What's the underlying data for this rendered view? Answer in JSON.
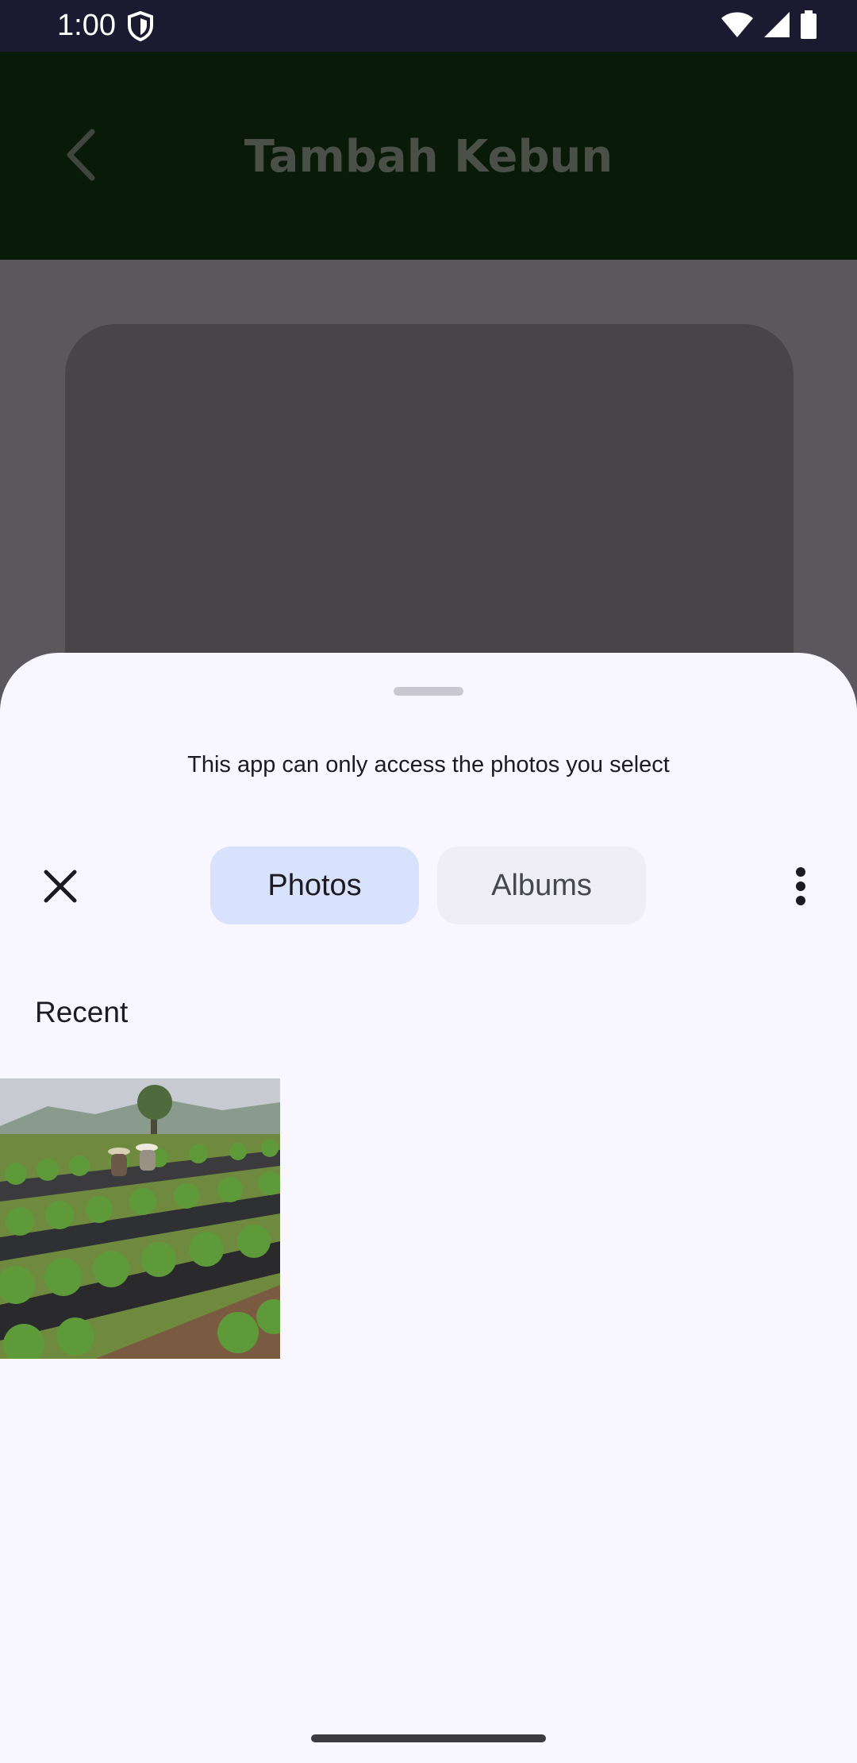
{
  "status_bar": {
    "time": "1:00",
    "icons": [
      "shield-icon",
      "wifi-icon",
      "cellular-signal-icon",
      "battery-icon"
    ]
  },
  "app": {
    "title": "Tambah Kebun",
    "back_icon": "chevron-left-icon"
  },
  "picker": {
    "message": "This app can only access the photos you select",
    "close_icon": "close-icon",
    "tabs": [
      {
        "label": "Photos",
        "selected": true
      },
      {
        "label": "Albums",
        "selected": false
      }
    ],
    "more_icon": "more-vert-icon",
    "section_label": "Recent",
    "photos": [
      {
        "kind": "thumbnail",
        "selected": false
      }
    ]
  },
  "colors": {
    "status_bar_bg": "#1c1a30",
    "sheet_bg": "#f8f7ff",
    "tab_selected_bg": "#d9e2fd",
    "tab_unselected_bg": "#efeef6"
  }
}
